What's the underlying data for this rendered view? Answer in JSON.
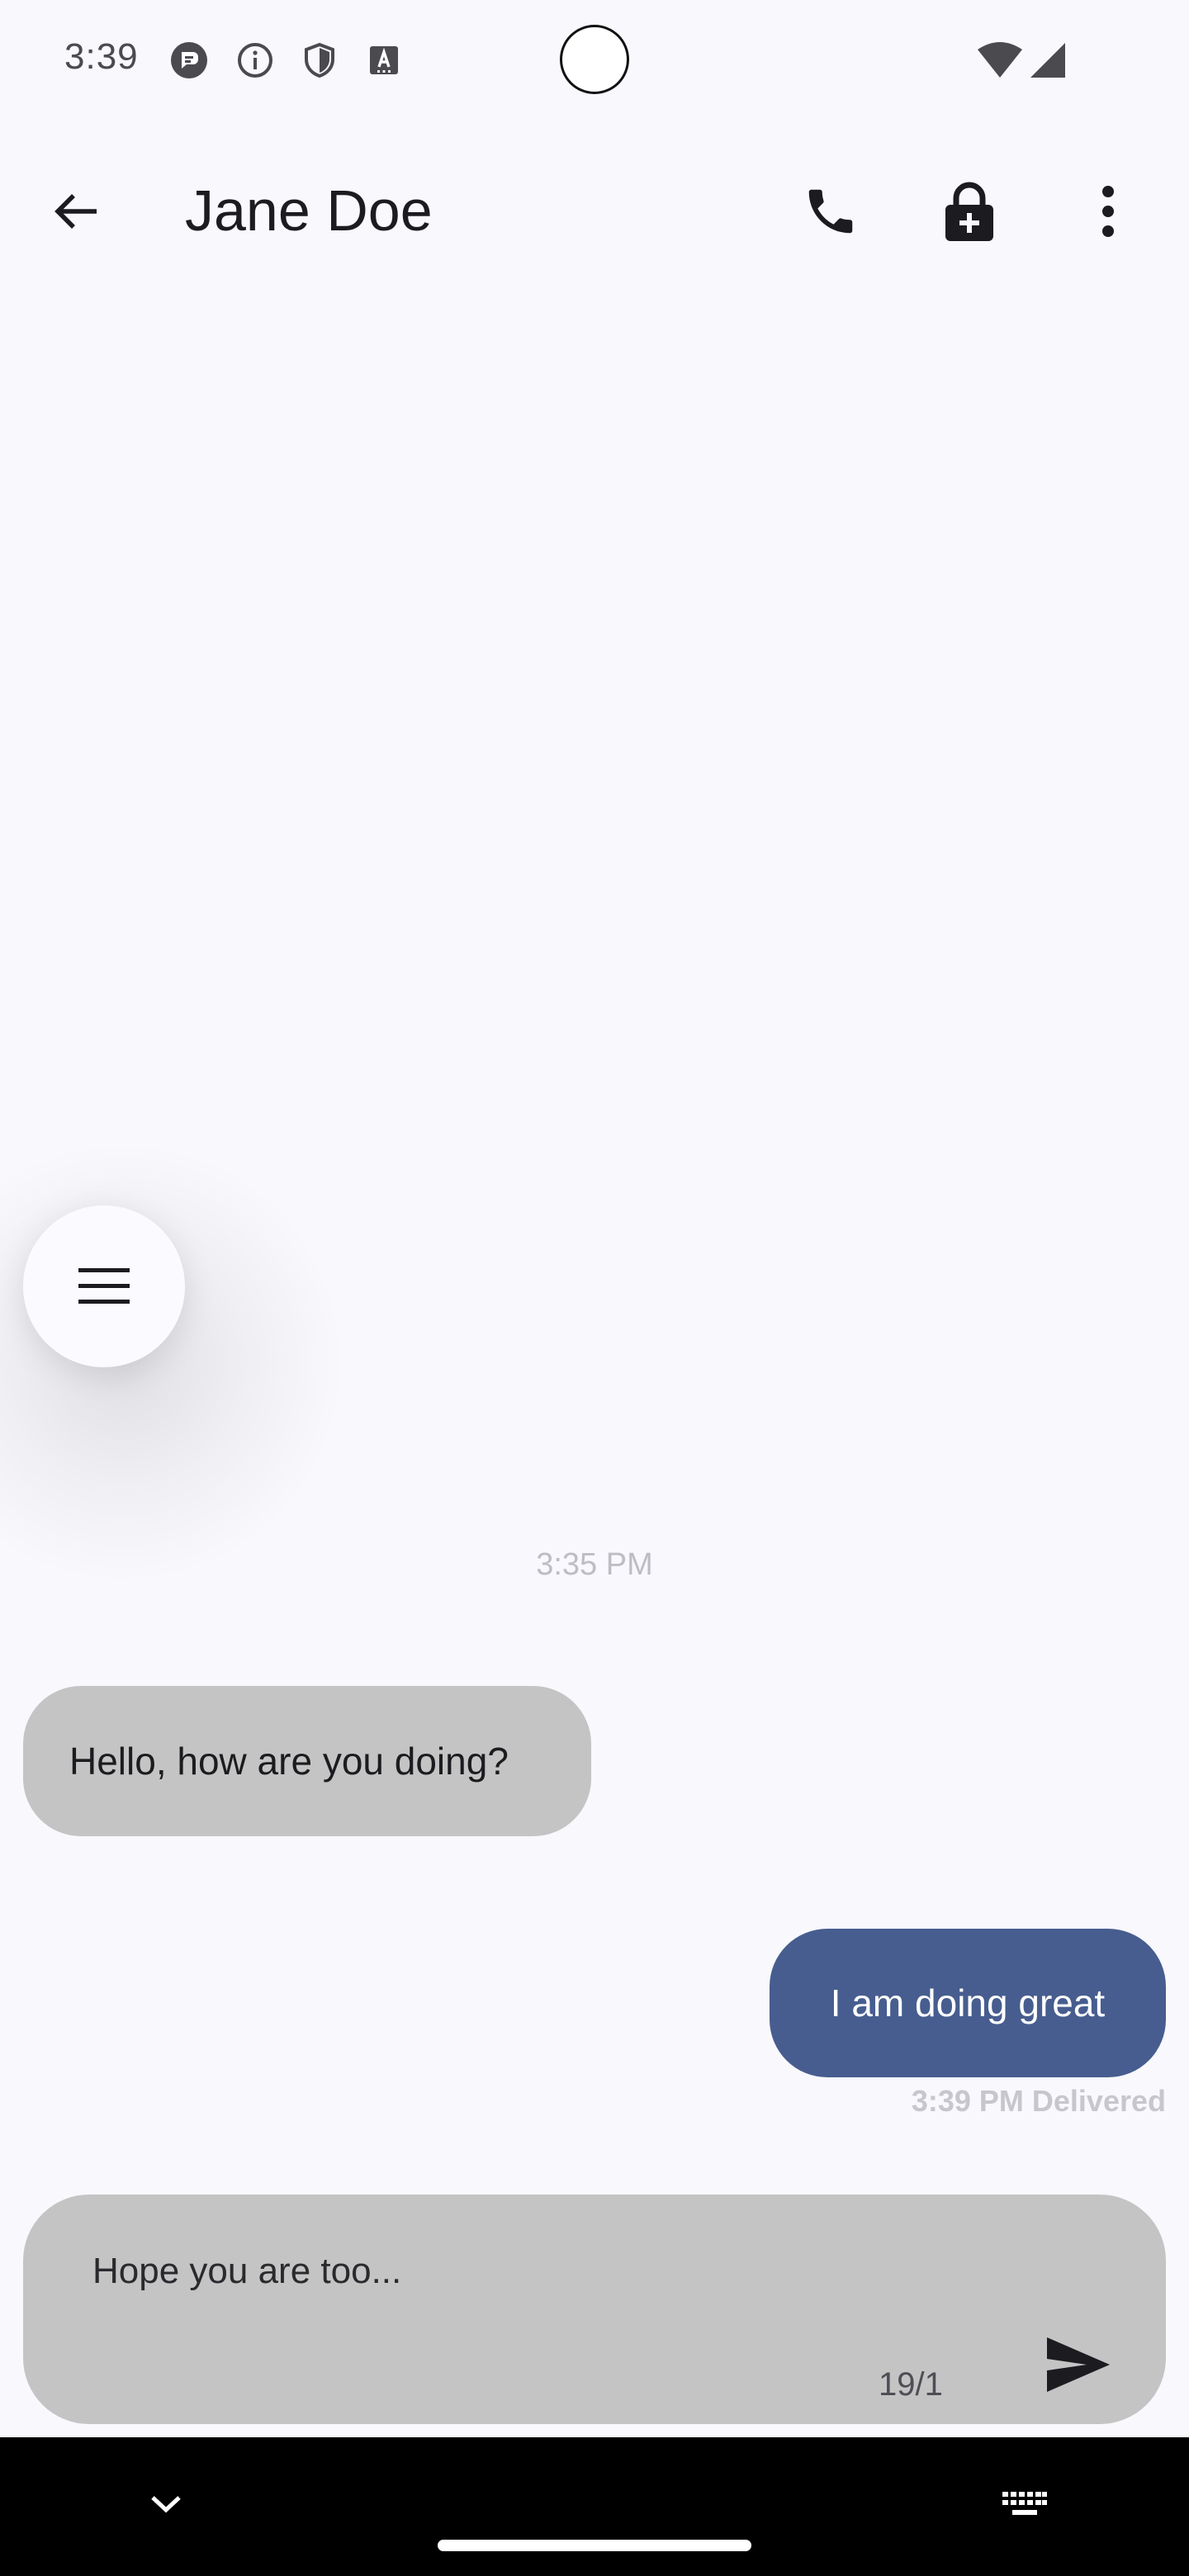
{
  "status_bar": {
    "time": "3:39",
    "notification_icons": [
      "message-notification-icon",
      "info-icon",
      "shield-icon",
      "translate-icon"
    ],
    "system_icons": [
      "wifi-icon",
      "cellular-signal-icon"
    ]
  },
  "app_bar": {
    "back_icon": "arrow-back-icon",
    "title": "Jane Doe",
    "action_icons": [
      "phone-icon",
      "lock-plus-icon",
      "more-vert-icon"
    ]
  },
  "floating_menu": {
    "icon": "menu-icon"
  },
  "conversation": {
    "time_separator": "3:35 PM",
    "messages": [
      {
        "direction": "incoming",
        "text": "Hello, how are you doing?"
      },
      {
        "direction": "outgoing",
        "text": "I am doing great",
        "meta": "3:39 PM Delivered"
      }
    ]
  },
  "composer": {
    "value": "Hope you are too...",
    "char_count": "19/1",
    "send_icon": "send-icon"
  },
  "nav_bar": {
    "hide_keyboard_icon": "chevron-down-icon",
    "keyboard_icon": "keyboard-icon"
  },
  "colors": {
    "background": "#f8f8fd",
    "incoming_bubble": "#c4c4c4",
    "outgoing_bubble": "#475d8f",
    "composer": "#c4c4c4",
    "nav_bar": "#000000"
  }
}
